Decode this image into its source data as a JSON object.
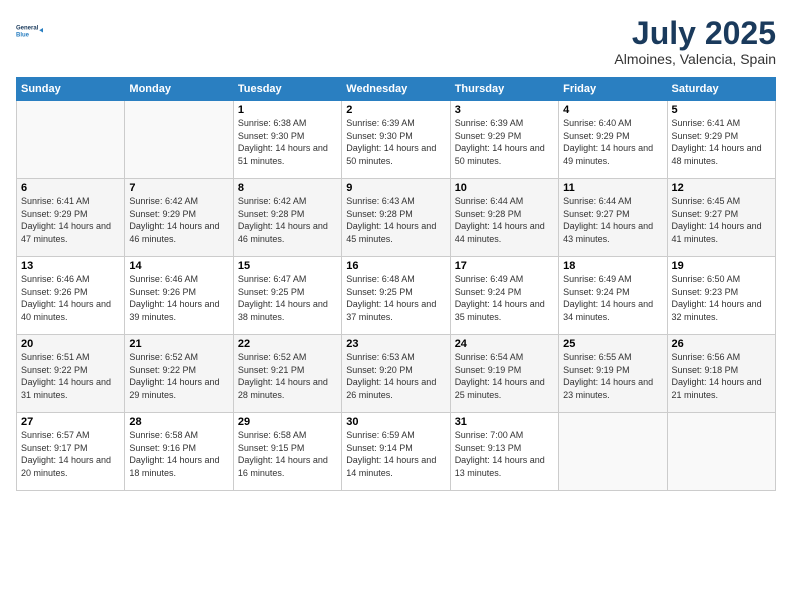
{
  "logo": {
    "line1": "General",
    "line2": "Blue"
  },
  "header": {
    "title": "July 2025",
    "subtitle": "Almoines, Valencia, Spain"
  },
  "weekdays": [
    "Sunday",
    "Monday",
    "Tuesday",
    "Wednesday",
    "Thursday",
    "Friday",
    "Saturday"
  ],
  "weeks": [
    [
      {
        "day": "",
        "info": ""
      },
      {
        "day": "",
        "info": ""
      },
      {
        "day": "1",
        "info": "Sunrise: 6:38 AM\nSunset: 9:30 PM\nDaylight: 14 hours and 51 minutes."
      },
      {
        "day": "2",
        "info": "Sunrise: 6:39 AM\nSunset: 9:30 PM\nDaylight: 14 hours and 50 minutes."
      },
      {
        "day": "3",
        "info": "Sunrise: 6:39 AM\nSunset: 9:29 PM\nDaylight: 14 hours and 50 minutes."
      },
      {
        "day": "4",
        "info": "Sunrise: 6:40 AM\nSunset: 9:29 PM\nDaylight: 14 hours and 49 minutes."
      },
      {
        "day": "5",
        "info": "Sunrise: 6:41 AM\nSunset: 9:29 PM\nDaylight: 14 hours and 48 minutes."
      }
    ],
    [
      {
        "day": "6",
        "info": "Sunrise: 6:41 AM\nSunset: 9:29 PM\nDaylight: 14 hours and 47 minutes."
      },
      {
        "day": "7",
        "info": "Sunrise: 6:42 AM\nSunset: 9:29 PM\nDaylight: 14 hours and 46 minutes."
      },
      {
        "day": "8",
        "info": "Sunrise: 6:42 AM\nSunset: 9:28 PM\nDaylight: 14 hours and 46 minutes."
      },
      {
        "day": "9",
        "info": "Sunrise: 6:43 AM\nSunset: 9:28 PM\nDaylight: 14 hours and 45 minutes."
      },
      {
        "day": "10",
        "info": "Sunrise: 6:44 AM\nSunset: 9:28 PM\nDaylight: 14 hours and 44 minutes."
      },
      {
        "day": "11",
        "info": "Sunrise: 6:44 AM\nSunset: 9:27 PM\nDaylight: 14 hours and 43 minutes."
      },
      {
        "day": "12",
        "info": "Sunrise: 6:45 AM\nSunset: 9:27 PM\nDaylight: 14 hours and 41 minutes."
      }
    ],
    [
      {
        "day": "13",
        "info": "Sunrise: 6:46 AM\nSunset: 9:26 PM\nDaylight: 14 hours and 40 minutes."
      },
      {
        "day": "14",
        "info": "Sunrise: 6:46 AM\nSunset: 9:26 PM\nDaylight: 14 hours and 39 minutes."
      },
      {
        "day": "15",
        "info": "Sunrise: 6:47 AM\nSunset: 9:25 PM\nDaylight: 14 hours and 38 minutes."
      },
      {
        "day": "16",
        "info": "Sunrise: 6:48 AM\nSunset: 9:25 PM\nDaylight: 14 hours and 37 minutes."
      },
      {
        "day": "17",
        "info": "Sunrise: 6:49 AM\nSunset: 9:24 PM\nDaylight: 14 hours and 35 minutes."
      },
      {
        "day": "18",
        "info": "Sunrise: 6:49 AM\nSunset: 9:24 PM\nDaylight: 14 hours and 34 minutes."
      },
      {
        "day": "19",
        "info": "Sunrise: 6:50 AM\nSunset: 9:23 PM\nDaylight: 14 hours and 32 minutes."
      }
    ],
    [
      {
        "day": "20",
        "info": "Sunrise: 6:51 AM\nSunset: 9:22 PM\nDaylight: 14 hours and 31 minutes."
      },
      {
        "day": "21",
        "info": "Sunrise: 6:52 AM\nSunset: 9:22 PM\nDaylight: 14 hours and 29 minutes."
      },
      {
        "day": "22",
        "info": "Sunrise: 6:52 AM\nSunset: 9:21 PM\nDaylight: 14 hours and 28 minutes."
      },
      {
        "day": "23",
        "info": "Sunrise: 6:53 AM\nSunset: 9:20 PM\nDaylight: 14 hours and 26 minutes."
      },
      {
        "day": "24",
        "info": "Sunrise: 6:54 AM\nSunset: 9:19 PM\nDaylight: 14 hours and 25 minutes."
      },
      {
        "day": "25",
        "info": "Sunrise: 6:55 AM\nSunset: 9:19 PM\nDaylight: 14 hours and 23 minutes."
      },
      {
        "day": "26",
        "info": "Sunrise: 6:56 AM\nSunset: 9:18 PM\nDaylight: 14 hours and 21 minutes."
      }
    ],
    [
      {
        "day": "27",
        "info": "Sunrise: 6:57 AM\nSunset: 9:17 PM\nDaylight: 14 hours and 20 minutes."
      },
      {
        "day": "28",
        "info": "Sunrise: 6:58 AM\nSunset: 9:16 PM\nDaylight: 14 hours and 18 minutes."
      },
      {
        "day": "29",
        "info": "Sunrise: 6:58 AM\nSunset: 9:15 PM\nDaylight: 14 hours and 16 minutes."
      },
      {
        "day": "30",
        "info": "Sunrise: 6:59 AM\nSunset: 9:14 PM\nDaylight: 14 hours and 14 minutes."
      },
      {
        "day": "31",
        "info": "Sunrise: 7:00 AM\nSunset: 9:13 PM\nDaylight: 14 hours and 13 minutes."
      },
      {
        "day": "",
        "info": ""
      },
      {
        "day": "",
        "info": ""
      }
    ]
  ]
}
